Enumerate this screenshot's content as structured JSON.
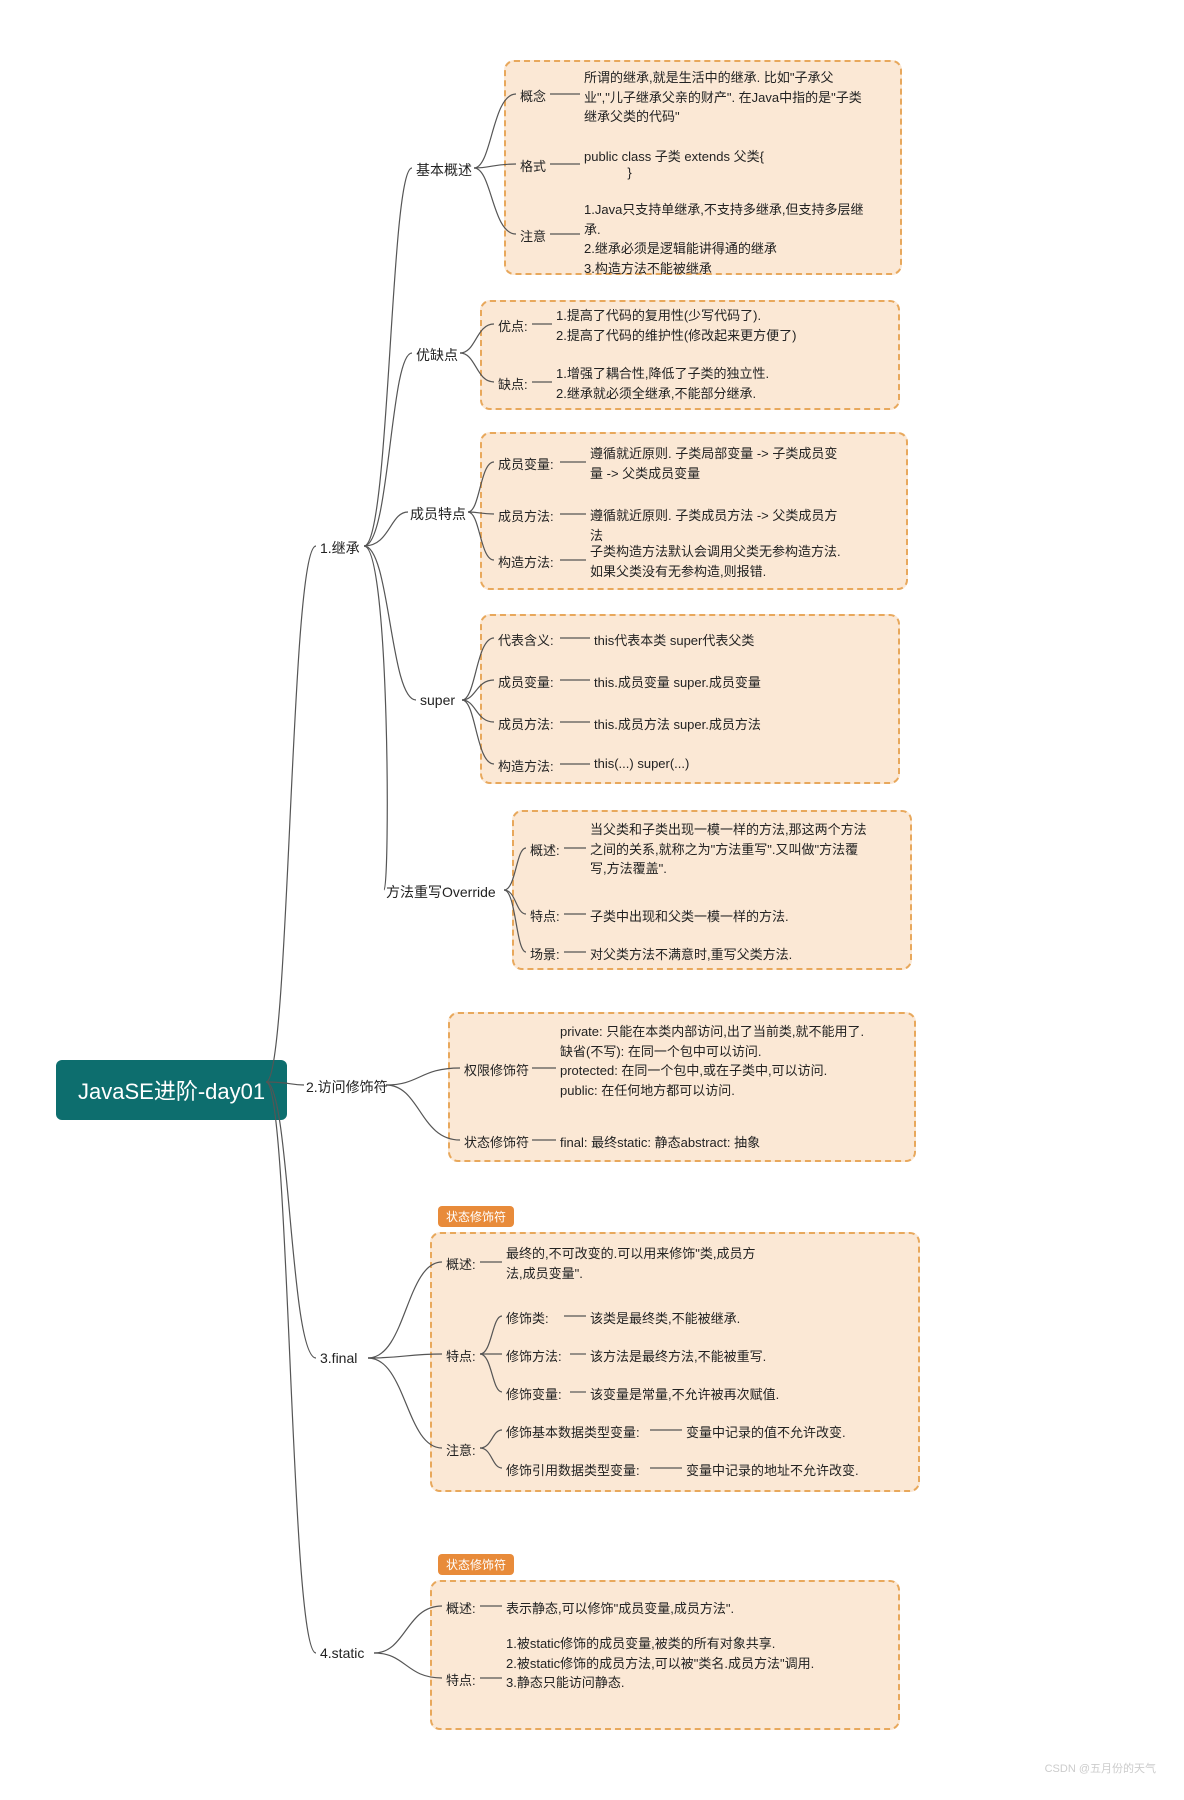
{
  "root": "JavaSE进阶-day01",
  "l1": {
    "a": "1.继承",
    "b": "2.访问修饰符",
    "c": "3.final",
    "d": "4.static"
  },
  "inherit": {
    "basic": {
      "label": "基本概述",
      "concept_l": "概念",
      "concept": "所谓的继承,就是生活中的继承. 比如\"子承父业\",\"儿子继承父亲的财产\". 在Java中指的是\"子类继承父类的代码\"",
      "format_l": "格式",
      "format": "public class 子类 extends 父类{\n            }",
      "note_l": "注意",
      "note": "1.Java只支持单继承,不支持多继承,但支持多层继承.\n2.继承必须是逻辑能讲得通的继承\n3.构造方法不能被继承"
    },
    "proscons": {
      "label": "优缺点",
      "pro_l": "优点:",
      "pro": "1.提高了代码的复用性(少写代码了).\n2.提高了代码的维护性(修改起来更方便了)",
      "con_l": "缺点:",
      "con": "1.增强了耦合性,降低了子类的独立性.\n2.继承就必须全继承,不能部分继承."
    },
    "member": {
      "label": "成员特点",
      "var_l": "成员变量:",
      "var": "遵循就近原则. 子类局部变量 -> 子类成员变量 -> 父类成员变量",
      "meth_l": "成员方法:",
      "meth": "遵循就近原则. 子类成员方法 -> 父类成员方法",
      "ctor_l": "构造方法:",
      "ctor": "子类构造方法默认会调用父类无参构造方法.如果父类没有无参构造,则报错."
    },
    "super": {
      "label": "super",
      "a_l": "代表含义:",
      "a": "this代表本类    super代表父类",
      "b_l": "成员变量:",
      "b": "this.成员变量   super.成员变量",
      "c_l": "成员方法:",
      "c": "this.成员方法   super.成员方法",
      "d_l": "构造方法:",
      "d": "this(...)     super(...)"
    },
    "override": {
      "label": "方法重写Override",
      "a_l": "概述:",
      "a": "当父类和子类出现一模一样的方法,那这两个方法之间的关系,就称之为\"方法重写\".又叫做\"方法覆写,方法覆盖\".",
      "b_l": "特点:",
      "b": "子类中出现和父类一模一样的方法.",
      "c_l": "场景:",
      "c": "对父类方法不满意时,重写父类方法."
    }
  },
  "access": {
    "perm_l": "权限修饰符",
    "perm": "private: 只能在本类内部访问,出了当前类,就不能用了.\n缺省(不写): 在同一个包中可以访问.\nprotected: 在同一个包中,或在子类中,可以访问.\npublic: 在任何地方都可以访问.",
    "state_l": "状态修饰符",
    "state": "final: 最终static: 静态abstract: 抽象"
  },
  "final": {
    "tag": "状态修饰符",
    "a_l": "概述:",
    "a": "最终的,不可改变的.可以用来修饰\"类,成员方法,成员变量\".",
    "b_l": "特点:",
    "b1_l": "修饰类:",
    "b1": "该类是最终类,不能被继承.",
    "b2_l": "修饰方法:",
    "b2": "该方法是最终方法,不能被重写.",
    "b3_l": "修饰变量:",
    "b3": "该变量是常量,不允许被再次赋值.",
    "c_l": "注意:",
    "c1_l": "修饰基本数据类型变量:",
    "c1": "变量中记录的值不允许改变.",
    "c2_l": "修饰引用数据类型变量:",
    "c2": "变量中记录的地址不允许改变."
  },
  "static": {
    "tag": "状态修饰符",
    "a_l": "概述:",
    "a": "表示静态,可以修饰\"成员变量,成员方法\".",
    "b_l": "特点:",
    "b": "1.被static修饰的成员变量,被类的所有对象共享.\n2.被static修饰的成员方法,可以被\"类名.成员方法\"调用.\n3.静态只能访问静态."
  },
  "watermark": "CSDN @五月份的天气",
  "chart_data": {
    "type": "mindmap",
    "root": "JavaSE进阶-day01",
    "children": [
      {
        "label": "1.继承",
        "children": [
          {
            "label": "基本概述",
            "children": [
              "概念",
              "格式",
              "注意"
            ]
          },
          {
            "label": "优缺点",
            "children": [
              "优点:",
              "缺点:"
            ]
          },
          {
            "label": "成员特点",
            "children": [
              "成员变量:",
              "成员方法:",
              "构造方法:"
            ]
          },
          {
            "label": "super",
            "children": [
              "代表含义:",
              "成员变量:",
              "成员方法:",
              "构造方法:"
            ]
          },
          {
            "label": "方法重写Override",
            "children": [
              "概述:",
              "特点:",
              "场景:"
            ]
          }
        ]
      },
      {
        "label": "2.访问修饰符",
        "children": [
          "权限修饰符",
          "状态修饰符"
        ]
      },
      {
        "label": "3.final",
        "children": [
          "概述:",
          "特点:",
          "注意:"
        ]
      },
      {
        "label": "4.static",
        "children": [
          "概述:",
          "特点:"
        ]
      }
    ]
  }
}
